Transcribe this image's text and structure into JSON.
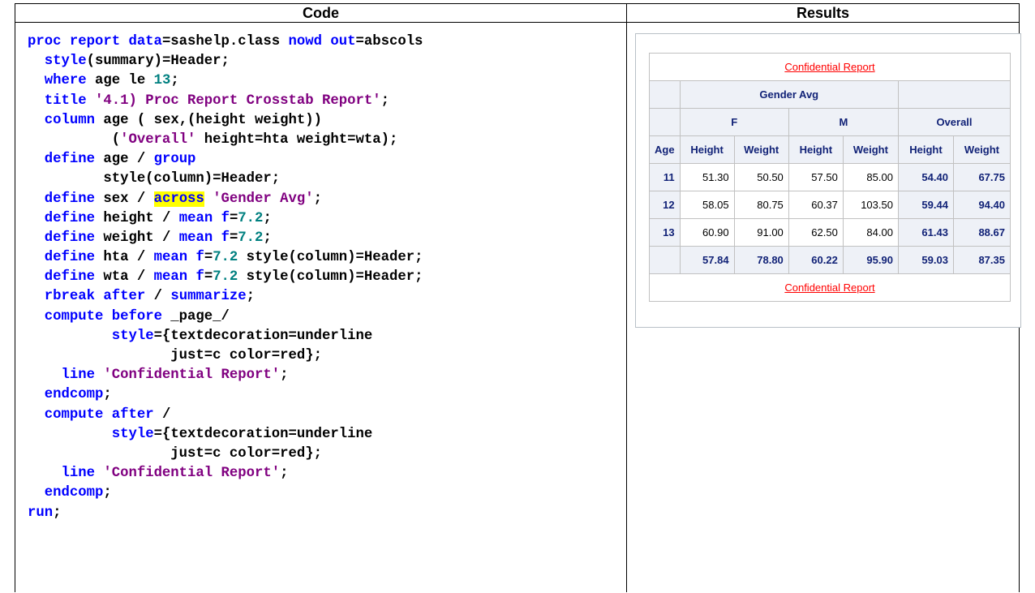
{
  "headers": {
    "code": "Code",
    "results": "Results"
  },
  "code_lines": [
    [
      [
        "kw",
        "proc report data"
      ],
      [
        "tx",
        "=sashelp.class "
      ],
      [
        "kw",
        "nowd out"
      ],
      [
        "tx",
        "=abscols"
      ]
    ],
    [
      [
        "tx",
        "  "
      ],
      [
        "kw",
        "style"
      ],
      [
        "tx",
        "(summary)=Header;"
      ]
    ],
    [
      [
        "tx",
        "  "
      ],
      [
        "kw",
        "where"
      ],
      [
        "tx",
        " age le "
      ],
      [
        "num",
        "13"
      ],
      [
        "tx",
        ";"
      ]
    ],
    [
      [
        "tx",
        "  "
      ],
      [
        "kw",
        "title"
      ],
      [
        "tx",
        " "
      ],
      [
        "str",
        "'4.1) Proc Report Crosstab Report'"
      ],
      [
        "tx",
        ";"
      ]
    ],
    [
      [
        "tx",
        "  "
      ],
      [
        "kw",
        "column"
      ],
      [
        "tx",
        " age ( sex,(height weight))"
      ]
    ],
    [
      [
        "tx",
        "          ("
      ],
      [
        "str",
        "'Overall'"
      ],
      [
        "tx",
        " height=hta weight=wta);"
      ]
    ],
    [
      [
        "tx",
        "  "
      ],
      [
        "kw",
        "define"
      ],
      [
        "tx",
        " age / "
      ],
      [
        "kw",
        "group"
      ]
    ],
    [
      [
        "tx",
        "         style(column)=Header;"
      ]
    ],
    [
      [
        "tx",
        "  "
      ],
      [
        "kw",
        "define"
      ],
      [
        "tx",
        " sex / "
      ],
      [
        "hl",
        "across"
      ],
      [
        "tx",
        " "
      ],
      [
        "str",
        "'Gender Avg'"
      ],
      [
        "tx",
        ";"
      ]
    ],
    [
      [
        "tx",
        "  "
      ],
      [
        "kw",
        "define"
      ],
      [
        "tx",
        " height / "
      ],
      [
        "kw",
        "mean"
      ],
      [
        "tx",
        " "
      ],
      [
        "kw",
        "f"
      ],
      [
        "tx",
        "="
      ],
      [
        "num",
        "7.2"
      ],
      [
        "tx",
        ";"
      ]
    ],
    [
      [
        "tx",
        "  "
      ],
      [
        "kw",
        "define"
      ],
      [
        "tx",
        " weight / "
      ],
      [
        "kw",
        "mean"
      ],
      [
        "tx",
        " "
      ],
      [
        "kw",
        "f"
      ],
      [
        "tx",
        "="
      ],
      [
        "num",
        "7.2"
      ],
      [
        "tx",
        ";"
      ]
    ],
    [
      [
        "tx",
        "  "
      ],
      [
        "kw",
        "define"
      ],
      [
        "tx",
        " hta / "
      ],
      [
        "kw",
        "mean"
      ],
      [
        "tx",
        " "
      ],
      [
        "kw",
        "f"
      ],
      [
        "tx",
        "="
      ],
      [
        "num",
        "7.2"
      ],
      [
        "tx",
        " style(column)=Header;"
      ]
    ],
    [
      [
        "tx",
        "  "
      ],
      [
        "kw",
        "define"
      ],
      [
        "tx",
        " wta / "
      ],
      [
        "kw",
        "mean"
      ],
      [
        "tx",
        " "
      ],
      [
        "kw",
        "f"
      ],
      [
        "tx",
        "="
      ],
      [
        "num",
        "7.2"
      ],
      [
        "tx",
        " style(column)=Header;"
      ]
    ],
    [
      [
        "tx",
        "  "
      ],
      [
        "kw",
        "rbreak after"
      ],
      [
        "tx",
        " / "
      ],
      [
        "kw",
        "summarize"
      ],
      [
        "tx",
        ";"
      ]
    ],
    [
      [
        "tx",
        "  "
      ],
      [
        "kw",
        "compute before"
      ],
      [
        "tx",
        " _page_/"
      ]
    ],
    [
      [
        "tx",
        "          "
      ],
      [
        "kw",
        "style"
      ],
      [
        "tx",
        "={textdecoration=underline"
      ]
    ],
    [
      [
        "tx",
        "                 just=c color=red};"
      ]
    ],
    [
      [
        "tx",
        "    "
      ],
      [
        "kw",
        "line"
      ],
      [
        "tx",
        " "
      ],
      [
        "str",
        "'Confidential Report'"
      ],
      [
        "tx",
        ";"
      ]
    ],
    [
      [
        "tx",
        "  "
      ],
      [
        "kw",
        "endcomp"
      ],
      [
        "tx",
        ";"
      ]
    ],
    [
      [
        "tx",
        "  "
      ],
      [
        "kw",
        "compute after"
      ],
      [
        "tx",
        " /"
      ]
    ],
    [
      [
        "tx",
        "          "
      ],
      [
        "kw",
        "style"
      ],
      [
        "tx",
        "={textdecoration=underline"
      ]
    ],
    [
      [
        "tx",
        "                 just=c color=red};"
      ]
    ],
    [
      [
        "tx",
        "    "
      ],
      [
        "kw",
        "line"
      ],
      [
        "tx",
        " "
      ],
      [
        "str",
        "'Confidential Report'"
      ],
      [
        "tx",
        ";"
      ]
    ],
    [
      [
        "tx",
        "  "
      ],
      [
        "kw",
        "endcomp"
      ],
      [
        "tx",
        ";"
      ]
    ],
    [
      [
        "kw",
        "run"
      ],
      [
        "tx",
        ";"
      ]
    ]
  ],
  "report": {
    "banner_top": "Confidential Report",
    "banner_bottom": "Confidential Report",
    "across_label": "Gender Avg",
    "groups": [
      "F",
      "M",
      "Overall"
    ],
    "col_age": "Age",
    "col_height": "Height",
    "col_weight": "Weight",
    "rows": [
      {
        "age": "11",
        "values": [
          "51.30",
          "50.50",
          "57.50",
          "85.00",
          "54.40",
          "67.75"
        ]
      },
      {
        "age": "12",
        "values": [
          "58.05",
          "80.75",
          "60.37",
          "103.50",
          "59.44",
          "94.40"
        ]
      },
      {
        "age": "13",
        "values": [
          "60.90",
          "91.00",
          "62.50",
          "84.00",
          "61.43",
          "88.67"
        ]
      }
    ],
    "summary": [
      "57.84",
      "78.80",
      "60.22",
      "95.90",
      "59.03",
      "87.35"
    ]
  }
}
